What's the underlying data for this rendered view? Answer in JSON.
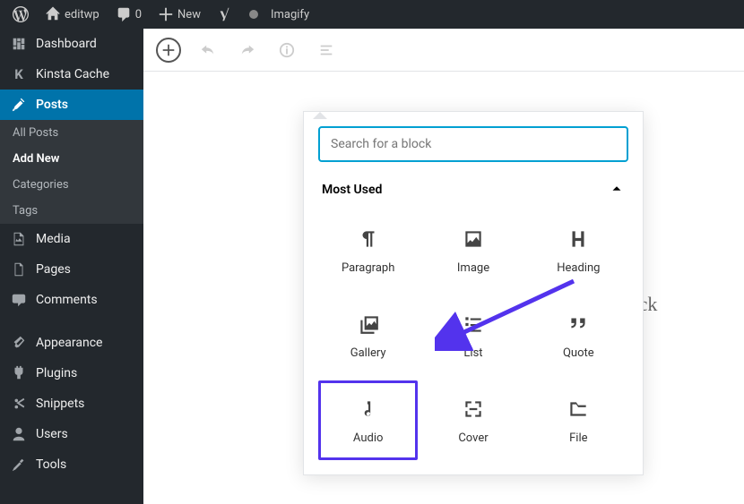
{
  "toolbar": {
    "site_name": "editwp",
    "comment_count": "0",
    "new_label": "New",
    "imagify_label": "Imagify"
  },
  "sidebar": {
    "dashboard": "Dashboard",
    "kinsta": "Kinsta Cache",
    "posts": "Posts",
    "posts_sub": {
      "all": "All Posts",
      "add_new": "Add New",
      "categories": "Categories",
      "tags": "Tags"
    },
    "media": "Media",
    "pages": "Pages",
    "comments": "Comments",
    "appearance": "Appearance",
    "plugins": "Plugins",
    "snippets": "Snippets",
    "users": "Users",
    "tools": "Tools"
  },
  "inserter": {
    "search_placeholder": "Search for a block",
    "section_title": "Most Used",
    "blocks": {
      "paragraph": "Paragraph",
      "image": "Image",
      "heading": "Heading",
      "gallery": "Gallery",
      "list": "List",
      "quote": "Quote",
      "audio": "Audio",
      "cover": "Cover",
      "file": "File"
    }
  },
  "canvas": {
    "hint_text": "to choose a block"
  }
}
